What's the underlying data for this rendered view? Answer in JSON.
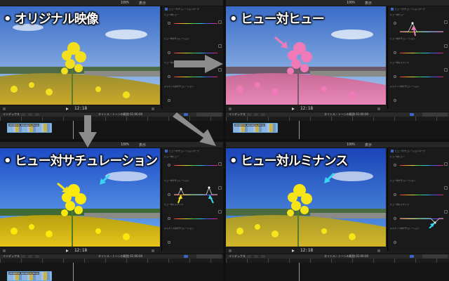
{
  "panels": [
    {
      "id": "original",
      "title": "• オリジナル映像",
      "effect": "none"
    },
    {
      "id": "hue-vs-hue",
      "title": "• ヒュー対ヒュー",
      "effect": "pink"
    },
    {
      "id": "hue-vs-sat",
      "title": "• ヒュー対サチュレーション",
      "effect": "vivid"
    },
    {
      "id": "hue-vs-lum",
      "title": "• ヒュー対ルミナンス",
      "effect": "bright"
    }
  ],
  "viewer": {
    "timecode": "12:18",
    "zoom": "100%",
    "view": "表示"
  },
  "inspector": {
    "title": "ヒュー/サチュレーションカーブ",
    "curves": [
      "ヒュー対ヒュー",
      "ヒュー対サチュレーション",
      "ヒュー対ルミナンス",
      "ルミナンス対サチュレーション"
    ]
  },
  "timeline": {
    "index_label": "インデックス",
    "clip_name": "20190316_Kamakura_Ebina",
    "timecode_mid": "タイトル・トーンの範囲   01:00:00",
    "restore_label": "カラーモードに戻す"
  },
  "colors": {
    "sky_top": "#2a5cc0",
    "sky_bottom": "#9cc6f0",
    "flower_yellow": "#f3e21e",
    "flower_pink": "#f07ab8",
    "annotation_yellow": "#f5e21e",
    "annotation_cyan": "#38d6f0",
    "annotation_pink": "#f07ab8"
  }
}
